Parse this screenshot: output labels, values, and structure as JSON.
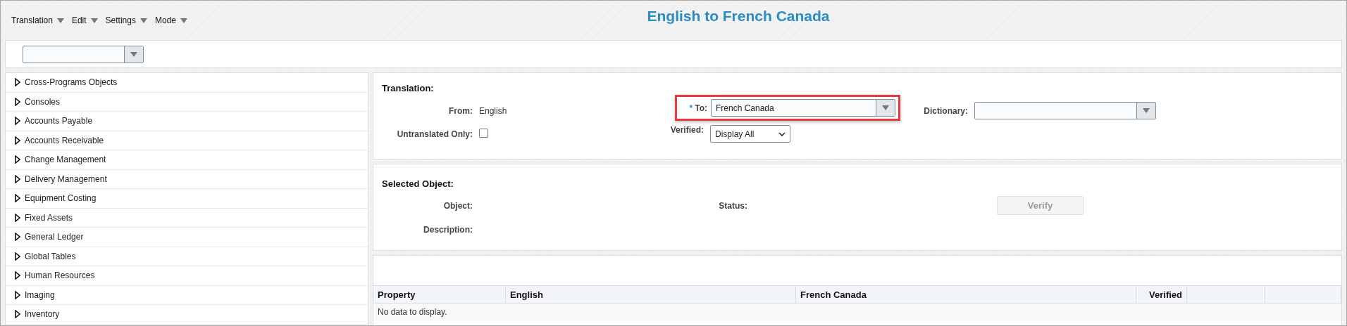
{
  "menu": [
    {
      "label": "Translation"
    },
    {
      "label": "Edit"
    },
    {
      "label": "Settings"
    },
    {
      "label": "Mode"
    }
  ],
  "title": "English to French Canada",
  "tree": [
    {
      "label": "Cross-Programs Objects",
      "expanded": false
    },
    {
      "label": "Consoles",
      "expanded": false
    },
    {
      "label": "Accounts Payable",
      "expanded": false
    },
    {
      "label": "Accounts Receivable",
      "expanded": false
    },
    {
      "label": "Change Management",
      "expanded": false
    },
    {
      "label": "Delivery Management",
      "expanded": false
    },
    {
      "label": "Equipment Costing",
      "expanded": false
    },
    {
      "label": "Fixed Assets",
      "expanded": false
    },
    {
      "label": "General Ledger",
      "expanded": false
    },
    {
      "label": "Global Tables",
      "expanded": false
    },
    {
      "label": "Human Resources",
      "expanded": false
    },
    {
      "label": "Imaging",
      "expanded": false
    },
    {
      "label": "Inventory",
      "expanded": false
    }
  ],
  "translation": {
    "heading": "Translation:",
    "from_label": "From:",
    "from_value": "English",
    "untranslated_label": "Untranslated Only:",
    "untranslated_checked": false,
    "required_mark": "*",
    "to_label": "To:",
    "to_value": "French Canada",
    "to_highlighted": true,
    "verified_label": "Verified:",
    "verified_value": "Display All",
    "dictionary_label": "Dictionary:"
  },
  "selected_object": {
    "heading": "Selected Object:",
    "object_label": "Object:",
    "description_label": "Description:",
    "status_label": "Status:",
    "verify_button": {
      "label": "Verify",
      "disabled": true
    }
  },
  "table": {
    "columns": [
      "Property",
      "English",
      "French Canada",
      "Verified"
    ],
    "empty_message": "No data to display."
  }
}
